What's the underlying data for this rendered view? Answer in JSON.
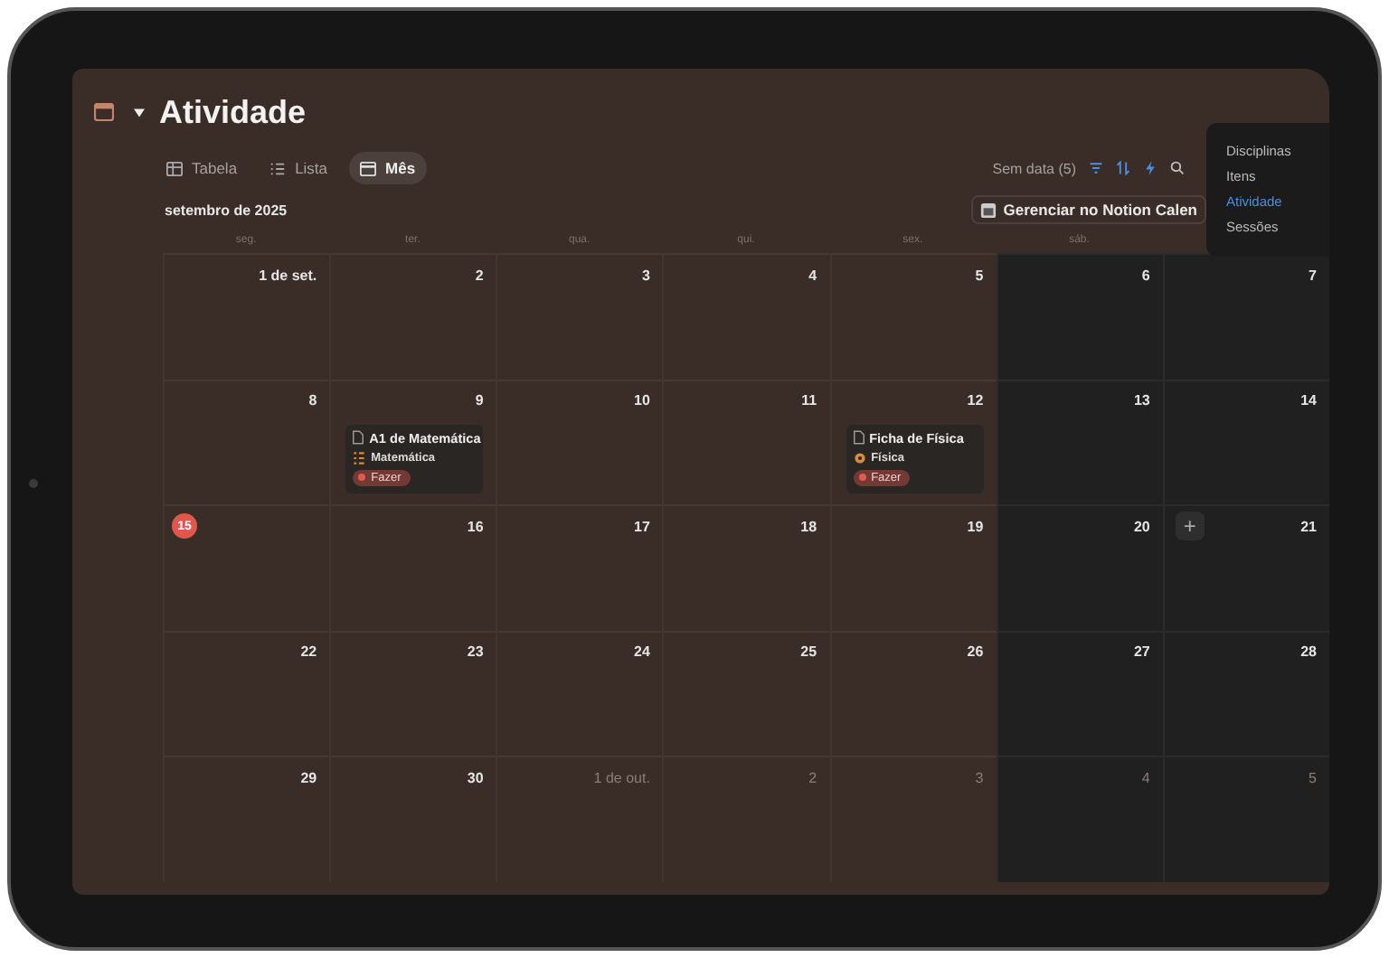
{
  "page": {
    "title": "Atividade"
  },
  "views": [
    {
      "label": "Tabela",
      "kind": "table",
      "selected": false
    },
    {
      "label": "Lista",
      "kind": "list",
      "selected": false
    },
    {
      "label": "Mês",
      "kind": "month",
      "selected": true
    }
  ],
  "toolbar": {
    "no_date": "Sem data (5)",
    "manage_button": "Gerenciar no Notion Calen"
  },
  "calendar": {
    "month": "setembro de 2025",
    "weekdays": [
      "seg.",
      "ter.",
      "qua.",
      "qui.",
      "sex.",
      "sáb."
    ],
    "weeks": [
      [
        {
          "label": "1 de set.",
          "in_month": true,
          "today": false
        },
        {
          "label": "2",
          "in_month": true,
          "today": false
        },
        {
          "label": "3",
          "in_month": true,
          "today": false
        },
        {
          "label": "4",
          "in_month": true,
          "today": false
        },
        {
          "label": "5",
          "in_month": true,
          "today": false
        },
        {
          "label": "6",
          "in_month": true,
          "today": false
        },
        {
          "label": "7",
          "in_month": true,
          "today": false
        }
      ],
      [
        {
          "label": "8",
          "in_month": true,
          "today": false
        },
        {
          "label": "9",
          "in_month": true,
          "today": false,
          "events": [
            {
              "title": "A1 de Matemática",
              "subject": {
                "label": "Matemática",
                "kind": "list"
              },
              "status": {
                "label": "Fazer",
                "color": "#e05a4f"
              }
            }
          ]
        },
        {
          "label": "10",
          "in_month": true,
          "today": false
        },
        {
          "label": "11",
          "in_month": true,
          "today": false
        },
        {
          "label": "12",
          "in_month": true,
          "today": false,
          "events": [
            {
              "title": "Ficha de Física",
              "subject": {
                "label": "Física",
                "kind": "atom"
              },
              "status": {
                "label": "Fazer",
                "color": "#e05a4f"
              }
            }
          ]
        },
        {
          "label": "13",
          "in_month": true,
          "today": false
        },
        {
          "label": "14",
          "in_month": true,
          "today": false
        }
      ],
      [
        {
          "label": "15",
          "in_month": true,
          "today": true
        },
        {
          "label": "16",
          "in_month": true,
          "today": false
        },
        {
          "label": "17",
          "in_month": true,
          "today": false
        },
        {
          "label": "18",
          "in_month": true,
          "today": false
        },
        {
          "label": "19",
          "in_month": true,
          "today": false
        },
        {
          "label": "20",
          "in_month": true,
          "today": false
        },
        {
          "label": "21",
          "in_month": true,
          "today": false,
          "add": "+"
        }
      ],
      [
        {
          "label": "22",
          "in_month": true,
          "today": false
        },
        {
          "label": "23",
          "in_month": true,
          "today": false
        },
        {
          "label": "24",
          "in_month": true,
          "today": false
        },
        {
          "label": "25",
          "in_month": true,
          "today": false
        },
        {
          "label": "26",
          "in_month": true,
          "today": false
        },
        {
          "label": "27",
          "in_month": true,
          "today": false
        },
        {
          "label": "28",
          "in_month": true,
          "today": false
        }
      ],
      [
        {
          "label": "29",
          "in_month": true,
          "today": false
        },
        {
          "label": "30",
          "in_month": true,
          "today": false
        },
        {
          "label": "1 de out.",
          "in_month": false,
          "today": false
        },
        {
          "label": "2",
          "in_month": false,
          "today": false
        },
        {
          "label": "3",
          "in_month": false,
          "today": false
        },
        {
          "label": "4",
          "in_month": false,
          "today": false
        },
        {
          "label": "5",
          "in_month": false,
          "today": false
        }
      ]
    ]
  },
  "database_menu": [
    {
      "label": "Disciplinas",
      "selected": false
    },
    {
      "label": "Itens",
      "selected": false
    },
    {
      "label": "Atividade",
      "selected": true
    },
    {
      "label": "Sessões",
      "selected": false
    }
  ]
}
